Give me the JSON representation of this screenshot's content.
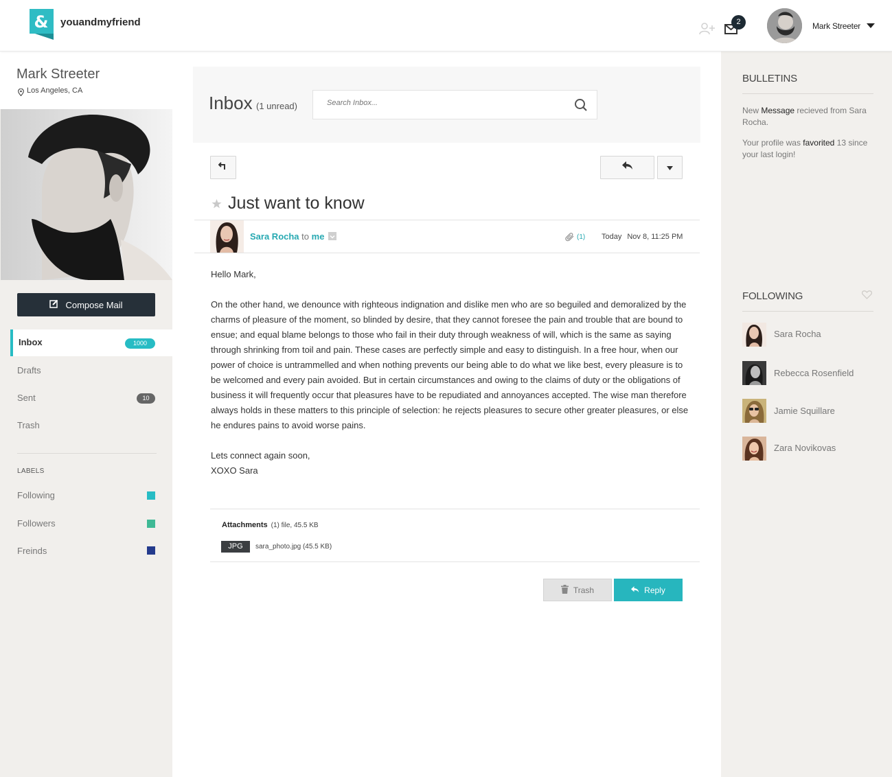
{
  "header": {
    "brand": "youandmyfriend",
    "messages_badge": "2",
    "user_name": "Mark Streeter"
  },
  "profile": {
    "name": "Mark Streeter",
    "location": "Los Angeles, CA"
  },
  "sidebar": {
    "compose_label": "Compose Mail",
    "folders": [
      {
        "label": "Inbox",
        "count": "1000"
      },
      {
        "label": "Drafts"
      },
      {
        "label": "Sent",
        "count": "10"
      },
      {
        "label": "Trash"
      }
    ],
    "labels_heading": "LABELS",
    "labels": [
      {
        "label": "Following",
        "color": "#27bcc4"
      },
      {
        "label": "Followers",
        "color": "#3fb995"
      },
      {
        "label": "Freinds",
        "color": "#243a8c"
      }
    ]
  },
  "inbox": {
    "title": "Inbox",
    "unread": "(1 unread)",
    "search_placeholder": "Search Inbox..."
  },
  "message": {
    "subject": "Just want to know",
    "sender": "Sara Rocha",
    "to_word": "to",
    "recipient": "me",
    "attachment_count": "(1)",
    "date_label": "Today",
    "date_value": "Nov 8, 11:25 PM",
    "greeting": "Hello Mark,",
    "body": "On the other hand, we denounce with righteous indignation and dislike men who are so beguiled and demoralized by the charms of pleasure of the moment, so blinded by desire, that they cannot foresee the pain and trouble that are bound to ensue; and equal blame belongs to those who fail in their duty through weakness of will, which is the same as saying through shrinking from toil and pain. These cases are perfectly simple and easy to distinguish. In a free hour, when our power of choice is untrammelled and when nothing prevents our being able to do what we like best, every pleasure is to be welcomed and every pain avoided. But in certain circumstances and owing to the claims of duty or the obligations of business it will frequently occur that pleasures have to be repudiated and annoyances accepted. The wise man therefore always holds in these matters to this principle of selection: he rejects pleasures to secure other greater pleasures, or else he endures pains to avoid worse pains.",
    "closing": "Lets connect again soon,",
    "signature": "XOXO Sara",
    "attachments_label": "Attachments",
    "attachments_meta": "(1)  file, 45.5 KB",
    "file_type": "JPG",
    "file_name": "sara_photo.jpg (45.5 KB)",
    "trash_label": "Trash",
    "reply_label": "Reply"
  },
  "right": {
    "bulletins_heading": "BULLETINS",
    "bulletin1": {
      "pre": "New ",
      "bold": "Message",
      "post": " recieved from Sara Rocha."
    },
    "bulletin2": {
      "pre": "Your profile was ",
      "bold": "favorited",
      "post": " 13 since your last login!"
    },
    "following_heading": "FOLLOWING",
    "following": [
      {
        "name": "Sara Rocha"
      },
      {
        "name": "Rebecca Rosenfield"
      },
      {
        "name": "Jamie Squillare"
      },
      {
        "name": "Zara Novikovas"
      }
    ]
  },
  "colors": {
    "accent": "#27bcc4",
    "dark": "#263039"
  }
}
